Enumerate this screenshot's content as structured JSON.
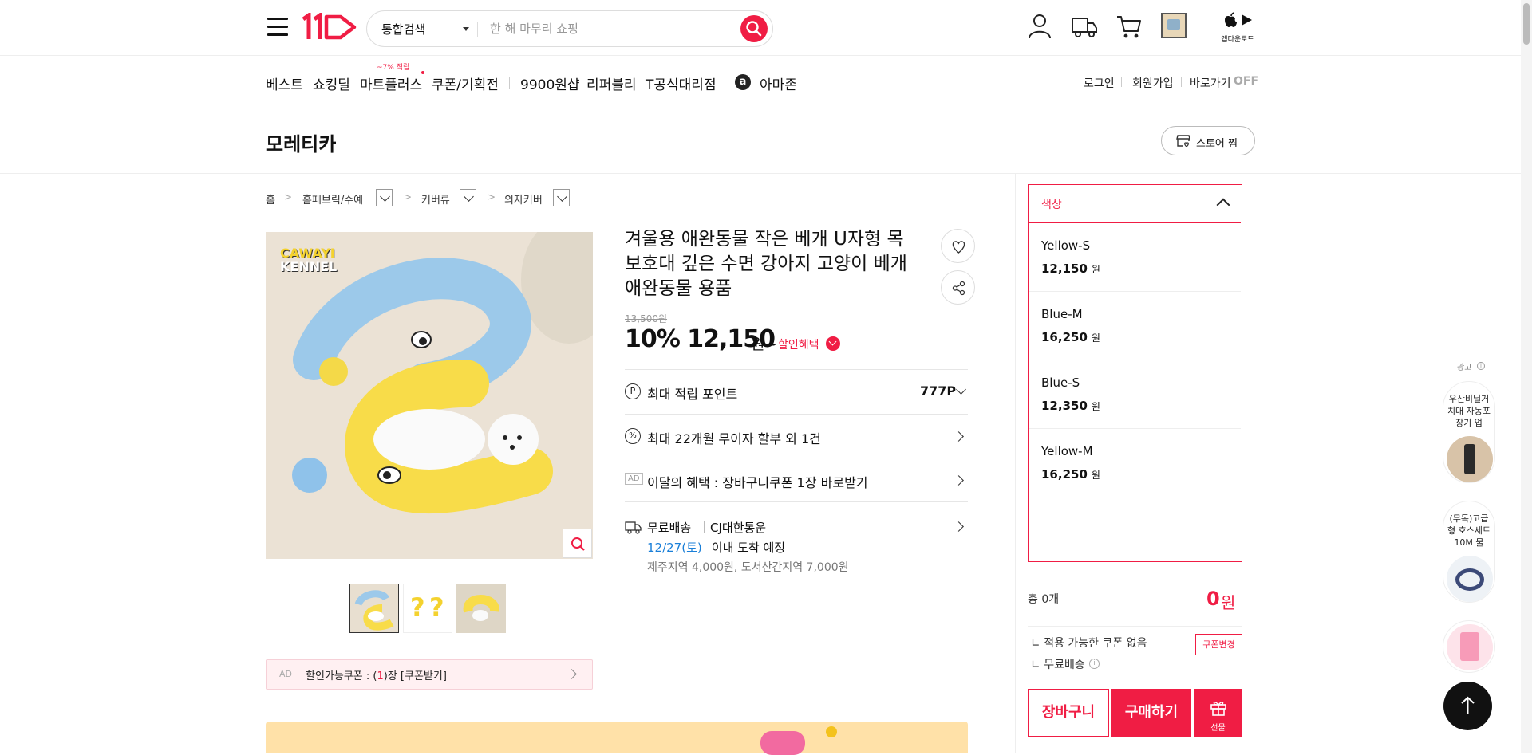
{
  "header": {
    "search_category": "통합검색",
    "search_placeholder": "한 해 마무리 쇼핑",
    "app_download": "앱다운로드"
  },
  "nav": {
    "items": [
      "베스트",
      "쇼킹딜",
      "마트플러스",
      "쿠폰/기획전",
      "9900원샵",
      "리퍼블리",
      "T공식대리점",
      "아마존"
    ],
    "mart_badge": "~7% 적립",
    "right": [
      "로그인",
      "회원가입",
      "바로가기"
    ],
    "shortcut_state": "OFF"
  },
  "store": {
    "name": "모레티카",
    "follow_label": "스토어 찜"
  },
  "breadcrumb": [
    "홈",
    "홈패브릭/수예",
    "커버류",
    "의자커버"
  ],
  "product": {
    "title": "겨울용 애완동물 작은 베개 U자형 목 보호대 깊은 수면 강아지 고양이 베개 애완동물 용품",
    "image_logo_line1": "CAWAYI",
    "image_logo_line2": "KENNEL",
    "original_price": "13,500원",
    "discount_rate": "10%",
    "price": "12,150",
    "price_unit": "원~",
    "discount_label": "할인혜택",
    "points_label": "최대 적립 포인트",
    "points_value": "777P",
    "installment": "최대 22개월 무이자 할부 외 1건",
    "ad_tag": "AD",
    "benefit": "이달의 혜택 : 장바구니쿠폰 1장 바로받기",
    "shipping_free": "무료배송",
    "shipping_carrier": "CJ대한통운",
    "arrival_date": "12/27(토)",
    "arrival_suffix": " 이내 도착 예정",
    "extra_fee": "제주지역 4,000원, 도서산간지역 7,000원",
    "coupon_tag": "AD",
    "coupon_text_pre": "할인가능쿠폰 : (",
    "coupon_count": "1",
    "coupon_text_post": ")장 [쿠폰받기]"
  },
  "options": {
    "title": "색상",
    "items": [
      {
        "name": "Yellow-S",
        "price": "12,150",
        "unit": "원"
      },
      {
        "name": "Blue-M",
        "price": "16,250",
        "unit": "원"
      },
      {
        "name": "Blue-S",
        "price": "12,350",
        "unit": "원"
      },
      {
        "name": "Yellow-M",
        "price": "16,250",
        "unit": "원"
      }
    ]
  },
  "order": {
    "total_label": "총 0개",
    "total_price": "0",
    "total_unit": "원",
    "no_coupon": "적용 가능한 쿠폰 없음",
    "coupon_change": "쿠폰변경",
    "free_shipping": "무료배송",
    "cart": "장바구니",
    "buy": "구매하기",
    "gift": "선물"
  },
  "ads_rail": {
    "label": "광고",
    "ad1": "우산비닐거치대 자동포장기 업",
    "ad2": "(무독)고급형 호스세트 10M 물"
  },
  "colors": {
    "accent": "#f01d44",
    "link_blue": "#1a7fd8"
  }
}
